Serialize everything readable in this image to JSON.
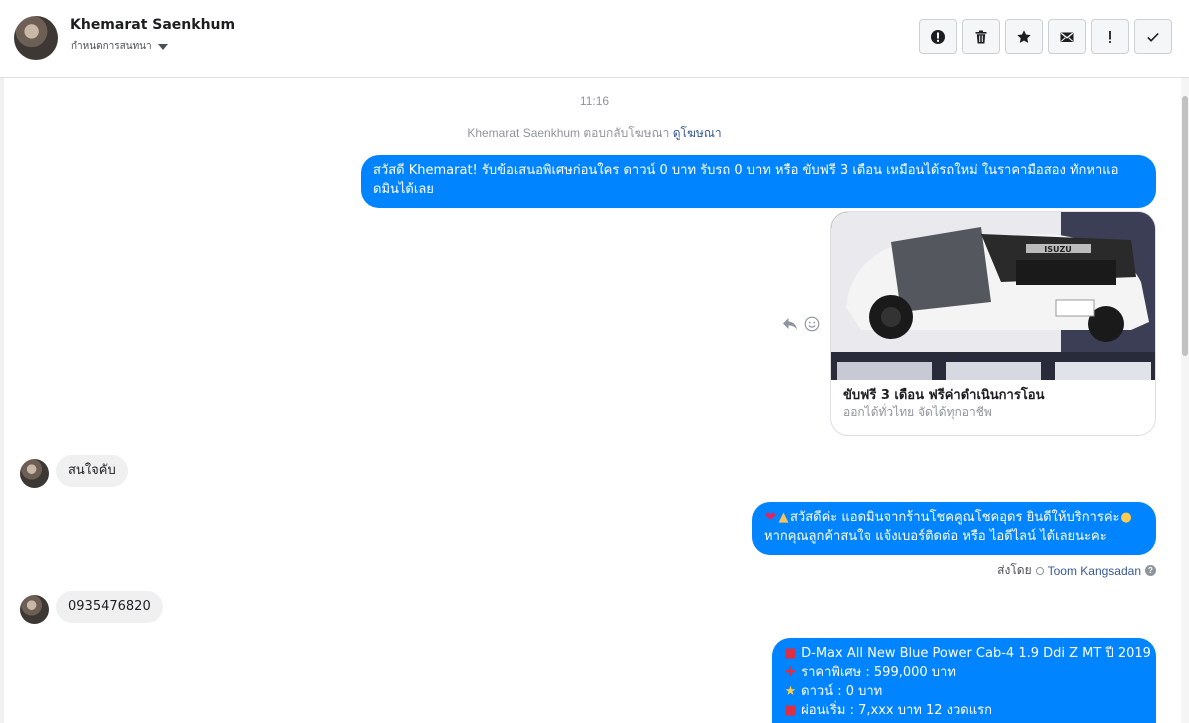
{
  "header": {
    "name": "Khemarat Saenkhum",
    "subtitle": "กำหนดการสนทนา"
  },
  "actions": [
    {
      "name": "report-button",
      "icon": "alert-circle-icon"
    },
    {
      "name": "delete-button",
      "icon": "trash-icon"
    },
    {
      "name": "star-button",
      "icon": "star-icon"
    },
    {
      "name": "mark-unread-button",
      "icon": "envelope-icon"
    },
    {
      "name": "important-button",
      "icon": "exclamation-icon"
    },
    {
      "name": "done-button",
      "icon": "checkmark-icon"
    }
  ],
  "conversation": {
    "time": "11:16",
    "reply_note": "Khemarat Saenkhum ตอบกลับโฆษณา",
    "reply_link": "ดูโฆษณา",
    "messages": {
      "m1_line1": "สวัสดี Khemarat! รับข้อเสนอพิเศษก่อนใคร ดาวน์ 0 บาท รับรถ 0 บาท หรือ ขับฟรี 3 เดือน เหมือนได้รถใหม่ ในราคามือสอง ทักหาแอ",
      "m1_line2": "ดมินได้เลย",
      "card_title": "ขับฟรี 3 เดือน ฟรีค่าดำเนินการโอน",
      "card_sub": "ออกได้ทั่วไทย จัดได้ทุกอาชีพ",
      "card_brand": "ISUZU",
      "in1": "สนใจคับ",
      "m2_line1": "สวัสดีค่ะ แอดมินจากร้านโชคคูณโชคอุดร ยินดีให้บริการค่ะ",
      "m2_line2": "หากคุณลูกค้าสนใจ แจ้งเบอร์ติดต่อ หรือ ไอดีไลน์ ได้เลยนะคะ",
      "sent_by_label": "ส่งโดย",
      "sent_by_name": "Toom Kangsadan",
      "in2": "0935476820",
      "m3_line1": "D-Max All New Blue Power Cab-4 1.9 Ddi Z MT ปี 2019",
      "m3_line2": "ราคาพิเศษ : 599,000 บาท",
      "m3_line3": "ดาวน์ : 0 บาท",
      "m3_line4": "ผ่อนเริ่ม : 7,xxx บาท 12 งวดแรก"
    }
  },
  "colors": {
    "outgoing": "#0084ff",
    "incoming": "#f1f0f0",
    "link": "#385898"
  }
}
